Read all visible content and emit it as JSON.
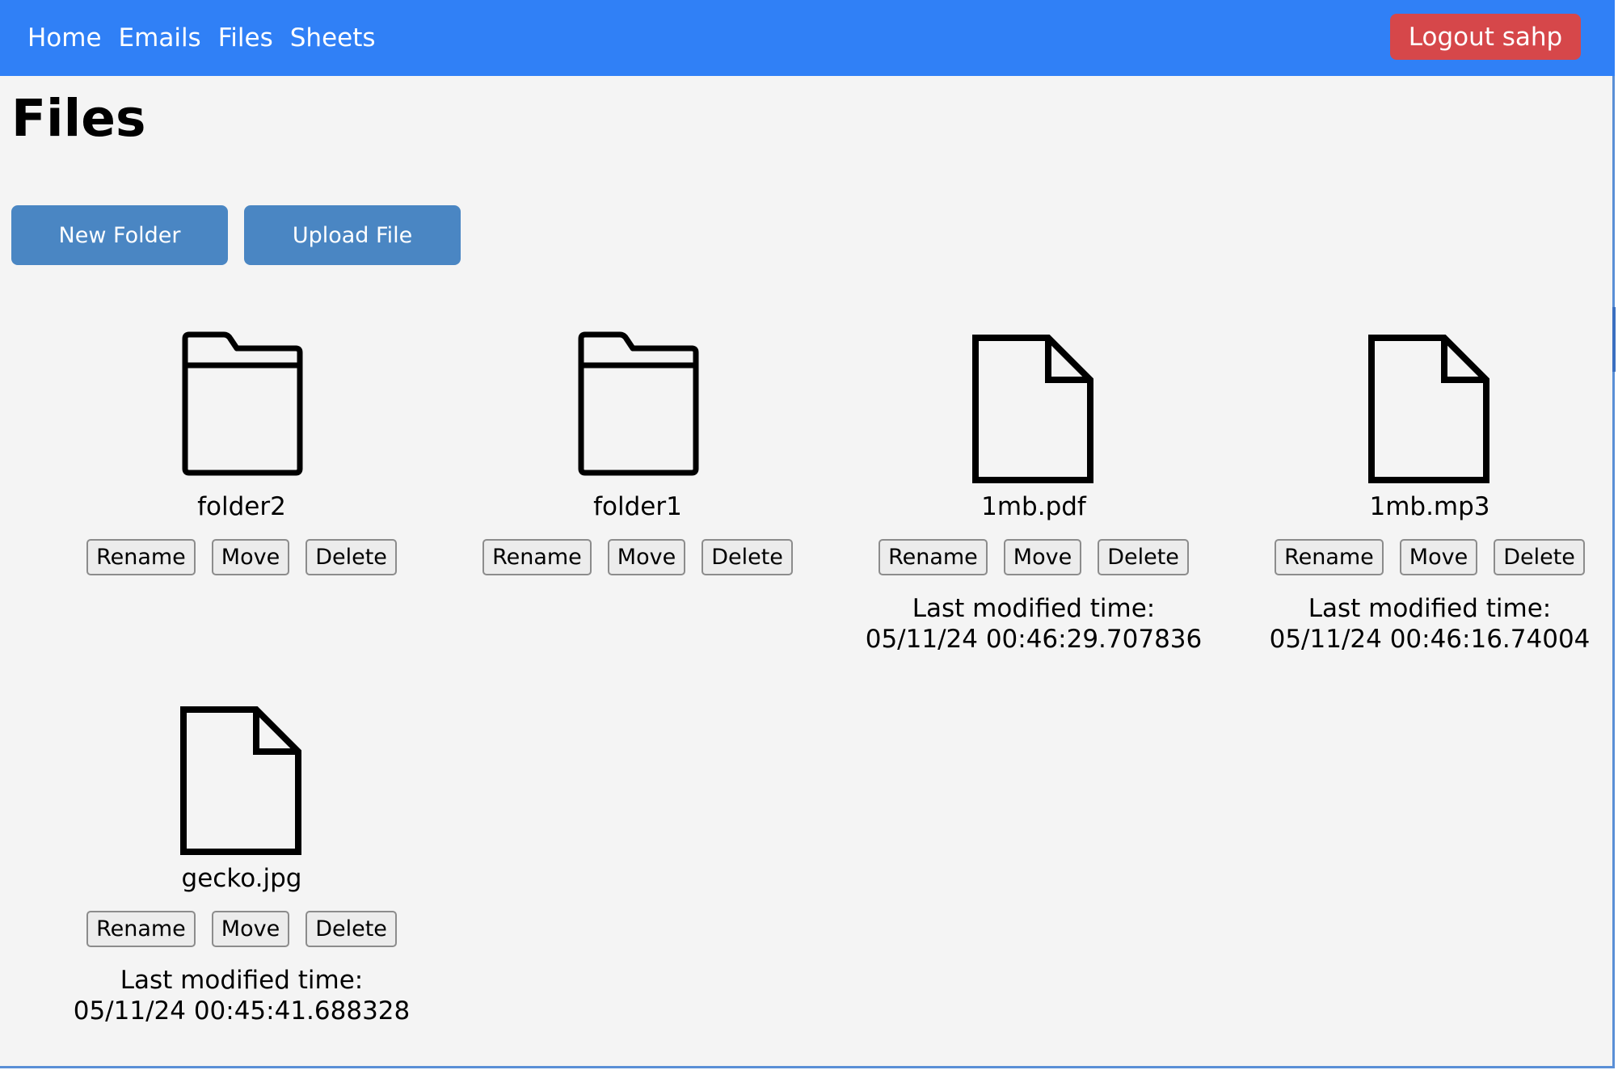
{
  "nav": {
    "links": [
      "Home",
      "Emails",
      "Files",
      "Sheets"
    ],
    "logout_label": "Logout sahp"
  },
  "page": {
    "title": "Files",
    "new_folder_label": "New Folder",
    "upload_file_label": "Upload File"
  },
  "items": [
    {
      "name": "folder2",
      "icon": "folder-icon",
      "rename": "Rename",
      "move": "Move",
      "delete": "Delete"
    },
    {
      "name": "folder1",
      "icon": "folder-icon",
      "rename": "Rename",
      "move": "Move",
      "delete": "Delete"
    },
    {
      "name": "1mb.pdf",
      "icon": "file-icon",
      "rename": "Rename",
      "move": "Move",
      "delete": "Delete",
      "modified_label": "Last modified time:",
      "modified_value": "05/11/24 00:46:29.707836"
    },
    {
      "name": "1mb.mp3",
      "icon": "file-icon",
      "rename": "Rename",
      "move": "Move",
      "delete": "Delete",
      "modified_label": "Last modified time:",
      "modified_value": "05/11/24 00:46:16.74004"
    },
    {
      "name": "gecko.jpg",
      "icon": "file-icon",
      "rename": "Rename",
      "move": "Move",
      "delete": "Delete",
      "modified_label": "Last modified time:",
      "modified_value": "05/11/24 00:45:41.688328"
    }
  ],
  "colors": {
    "navbar": "#3080f6",
    "logout": "#d6474a",
    "action_button": "#4a86c3",
    "background": "#f4f4f4"
  }
}
